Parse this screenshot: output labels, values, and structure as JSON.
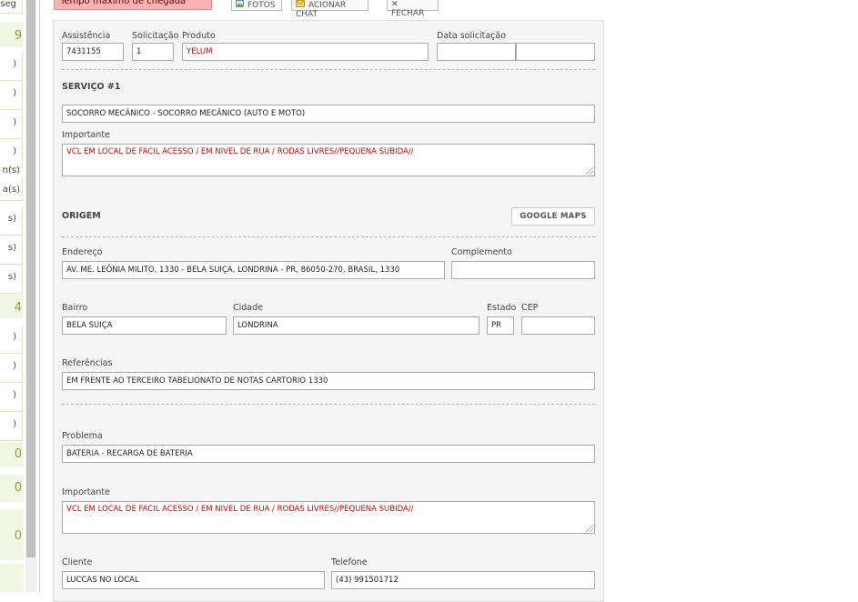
{
  "top_bar": {
    "alert_text": "Tempo máximo de chegada minuto(s)",
    "fotos_label": "FOTOS",
    "chat_label": "ACIONAR CHAT",
    "close_label": "FECHAR"
  },
  "left_strip": {
    "items": [
      "seg",
      ")",
      ")",
      ")",
      ")",
      "n(s)",
      "a(s)",
      "s)",
      "s)",
      "s)",
      ")",
      ")",
      ")",
      ")"
    ],
    "counts": [
      "9",
      "4",
      "0",
      "0",
      "0"
    ]
  },
  "form": {
    "assistencia": {
      "label": "Assistência",
      "value": "7431155"
    },
    "solicitacao": {
      "label": "Solicitação",
      "value": "1"
    },
    "produto": {
      "label": "Produto",
      "value": "YELUM"
    },
    "data_solicitacao": {
      "label": "Data solicitação",
      "date": "",
      "time": ""
    },
    "servico_title": "SERVIÇO #1",
    "servico_value": "SOCORRO MECÂNICO - SOCORRO MECÂNICO (AUTO E MOTO)",
    "importante1": {
      "label": "Importante",
      "value": "VCL EM LOCAL DE FACIL ACESSO / EM NIVEL DE RUA / RODAS LIVRES//PEQUENA SUBIDA//"
    },
    "origem_title": "ORIGEM",
    "google_maps_label": "GOOGLE MAPS",
    "endereco": {
      "label": "Endereço",
      "value": "AV. ME. LEÔNIA MILITO, 1330 - BELA SUIÇA, LONDRINA - PR, 86050-270, BRASIL, 1330"
    },
    "complemento": {
      "label": "Complemento",
      "value": ""
    },
    "bairro": {
      "label": "Bairro",
      "value": "BELA SUIÇA"
    },
    "cidade": {
      "label": "Cidade",
      "value": "LONDRINA"
    },
    "estado": {
      "label": "Estado",
      "value": "PR"
    },
    "cep": {
      "label": "CEP",
      "value": ""
    },
    "referencias": {
      "label": "Referências",
      "value": "EM FRENTE AO TERCEIRO TABELIONATO DE NOTAS CARTORIO 1330"
    },
    "problema": {
      "label": "Problema",
      "value": "BATERIA - RECARGA DE BATERIA"
    },
    "importante2": {
      "label": "Importante",
      "value": "VCL EM LOCAL DE FACIL ACESSO / EM NIVEL DE RUA / RODAS LIVRES//PEQUENA SUBIDA//"
    },
    "cliente": {
      "label": "Cliente",
      "value": "LUCCAS NO LOCAL"
    },
    "telefone": {
      "label": "Telefone",
      "value": "(43) 991501712"
    }
  },
  "colors": {
    "alert_bg": "#f8b3b3",
    "accent_green": "#8aa93c",
    "highlight_text": "#d60000"
  },
  "icons": {
    "fotos": "image-icon",
    "chat": "envelope-icon",
    "close": "close-icon"
  }
}
